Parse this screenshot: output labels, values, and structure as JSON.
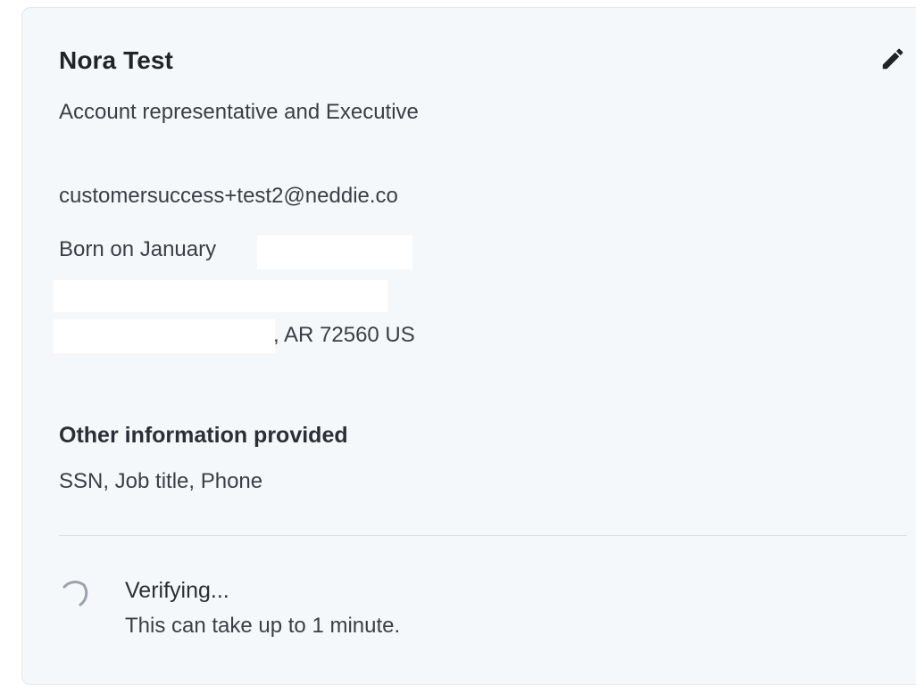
{
  "profile": {
    "name": "Nora Test",
    "job_title": "Account representative and Executive",
    "email": "customersuccess+test2@neddie.co",
    "birth_prefix": "Born on January",
    "address_line_2_suffix": ", AR 72560 US"
  },
  "other_info": {
    "heading": "Other information provided",
    "items": "SSN, Job title, Phone"
  },
  "status": {
    "title": "Verifying...",
    "subtitle": "This can take up to 1 minute."
  },
  "icons": {
    "edit": "pencil-icon",
    "spinner": "loading-spinner-icon"
  },
  "colors": {
    "card_background": "#f5f8fa",
    "text_primary": "#1f2429",
    "text_secondary": "#3a3f45"
  }
}
